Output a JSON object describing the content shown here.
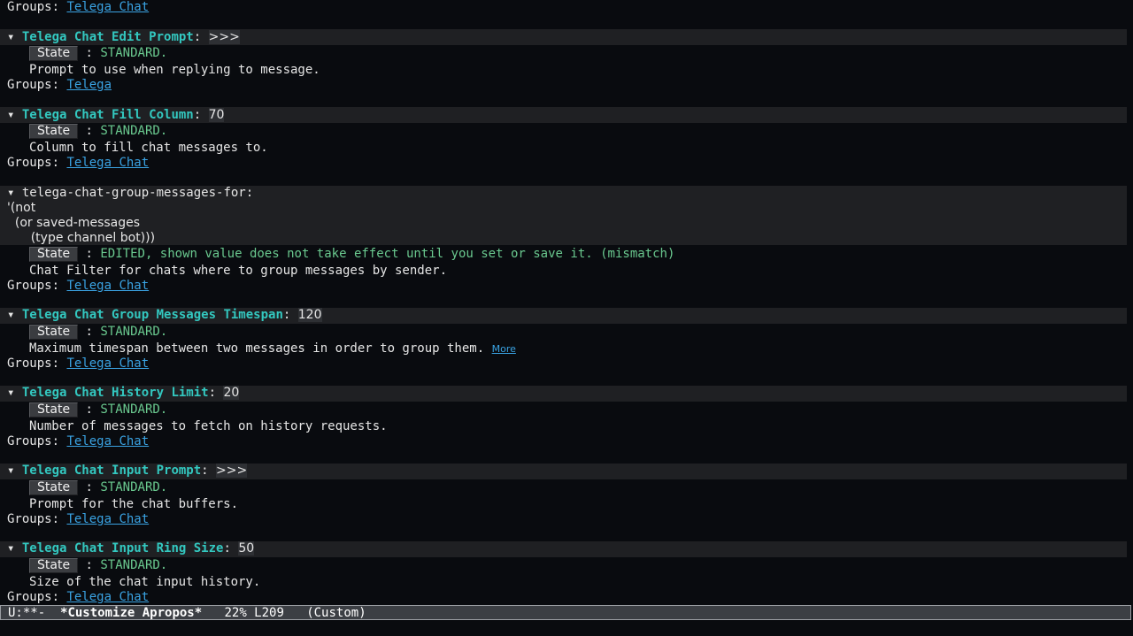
{
  "groups_label": "Groups:",
  "state_button": "State",
  "state_sep": ":",
  "colon": ":",
  "triangle": "▾",
  "first_group_link": "Telega Chat",
  "options": [
    {
      "name": "Telega Chat Edit Prompt",
      "value": ">>>",
      "state": "STANDARD.",
      "doc": "Prompt to use when replying to message.",
      "group": "Telega"
    },
    {
      "name": "Telega Chat Fill Column",
      "value": "70",
      "state": "STANDARD.",
      "doc": "Column to fill chat messages to.",
      "group": "Telega Chat"
    },
    {
      "name": "telega-chat-group-messages-for:",
      "value_lines": [
        "'(not",
        "  (or saved-messages",
        "      (type channel bot)))"
      ],
      "state": "EDITED, shown value does not take effect until you set or save it. (mismatch)",
      "doc": "Chat Filter for chats where to group messages by sender.",
      "group": "Telega Chat"
    },
    {
      "name": "Telega Chat Group Messages Timespan",
      "value": "120",
      "state": "STANDARD.",
      "doc": "Maximum timespan between two messages in order to group them.",
      "more": "More",
      "group": "Telega Chat"
    },
    {
      "name": "Telega Chat History Limit",
      "value": "20",
      "state": "STANDARD.",
      "doc": "Number of messages to fetch on history requests.",
      "group": "Telega Chat"
    },
    {
      "name": "Telega Chat Input Prompt",
      "value": ">>>",
      "state": "STANDARD.",
      "doc": "Prompt for the chat buffers.",
      "group": "Telega Chat"
    },
    {
      "name": "Telega Chat Input Ring Size",
      "value": "50",
      "state": "STANDARD.",
      "doc": "Size of the chat input history.",
      "group": "Telega Chat"
    }
  ],
  "modeline": {
    "status": "U:**-",
    "buffer": "*Customize Apropos*",
    "position": "22% L209",
    "mode": "(Custom)"
  }
}
